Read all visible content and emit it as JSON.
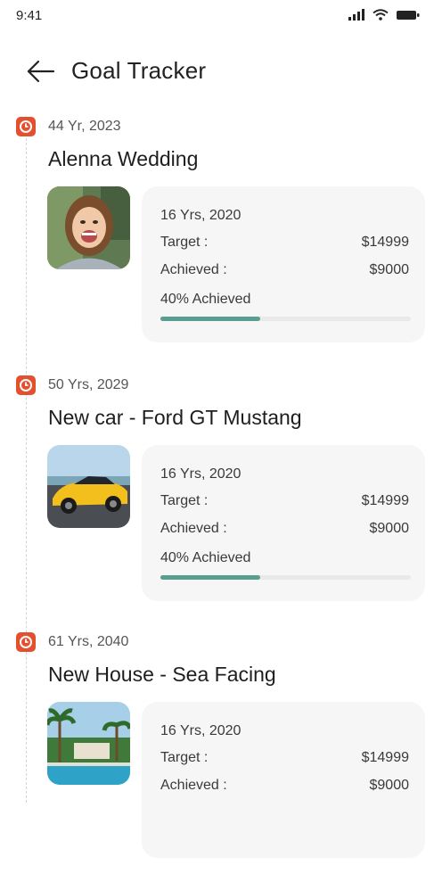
{
  "status_bar": {
    "time": "9:41"
  },
  "header": {
    "title": "Goal Tracker"
  },
  "goals": [
    {
      "date": "44 Yr, 2023",
      "title": "Alenna Wedding",
      "image": "girl-portrait",
      "period": "16 Yrs, 2020",
      "target_label": "Target  :",
      "target_value": "$14999",
      "achieved_label": "Achieved :",
      "achieved_value": "$9000",
      "progress_text": "40% Achieved",
      "progress": 0.4
    },
    {
      "date": "50 Yrs, 2029",
      "title": "New car - Ford GT Mustang",
      "image": "yellow-sports-car",
      "period": "16 Yrs, 2020",
      "target_label": "Target  :",
      "target_value": "$14999",
      "achieved_label": "Achieved :",
      "achieved_value": "$9000",
      "progress_text": "40% Achieved",
      "progress": 0.4
    },
    {
      "date": "61 Yrs, 2040",
      "title": "New House - Sea Facing",
      "image": "resort-pool",
      "period": "16 Yrs, 2020",
      "target_label": "Target  :",
      "target_value": "$14999",
      "achieved_label": "Achieved :",
      "achieved_value": "$9000"
    }
  ],
  "colors": {
    "marker": "#e4502f",
    "progress": "#5a9e92",
    "card": "#f6f6f6"
  }
}
